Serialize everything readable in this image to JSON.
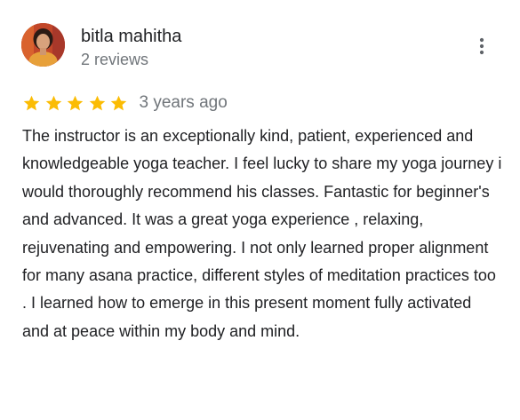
{
  "review": {
    "reviewer_name": "bitla mahitha",
    "review_count": "2 reviews",
    "rating": 5,
    "rating_max": 5,
    "star_color": "#fbbc04",
    "date": "3 years ago",
    "text": "The instructor is an exceptionally kind, patient, experienced and knowledgeable yoga teacher. I feel lucky to share my yoga journey i would thoroughly recommend his classes. Fantastic for beginner's and advanced. It was a great yoga experience , relaxing, rejuvenating and empowering. I not only learned proper alignment for many asana practice, different styles of meditation practices too . I learned how to emerge in this present moment fully activated and at peace within my body and mind.",
    "more_icon": "vertical-ellipsis-icon",
    "avatar_icon": "profile-photo"
  }
}
